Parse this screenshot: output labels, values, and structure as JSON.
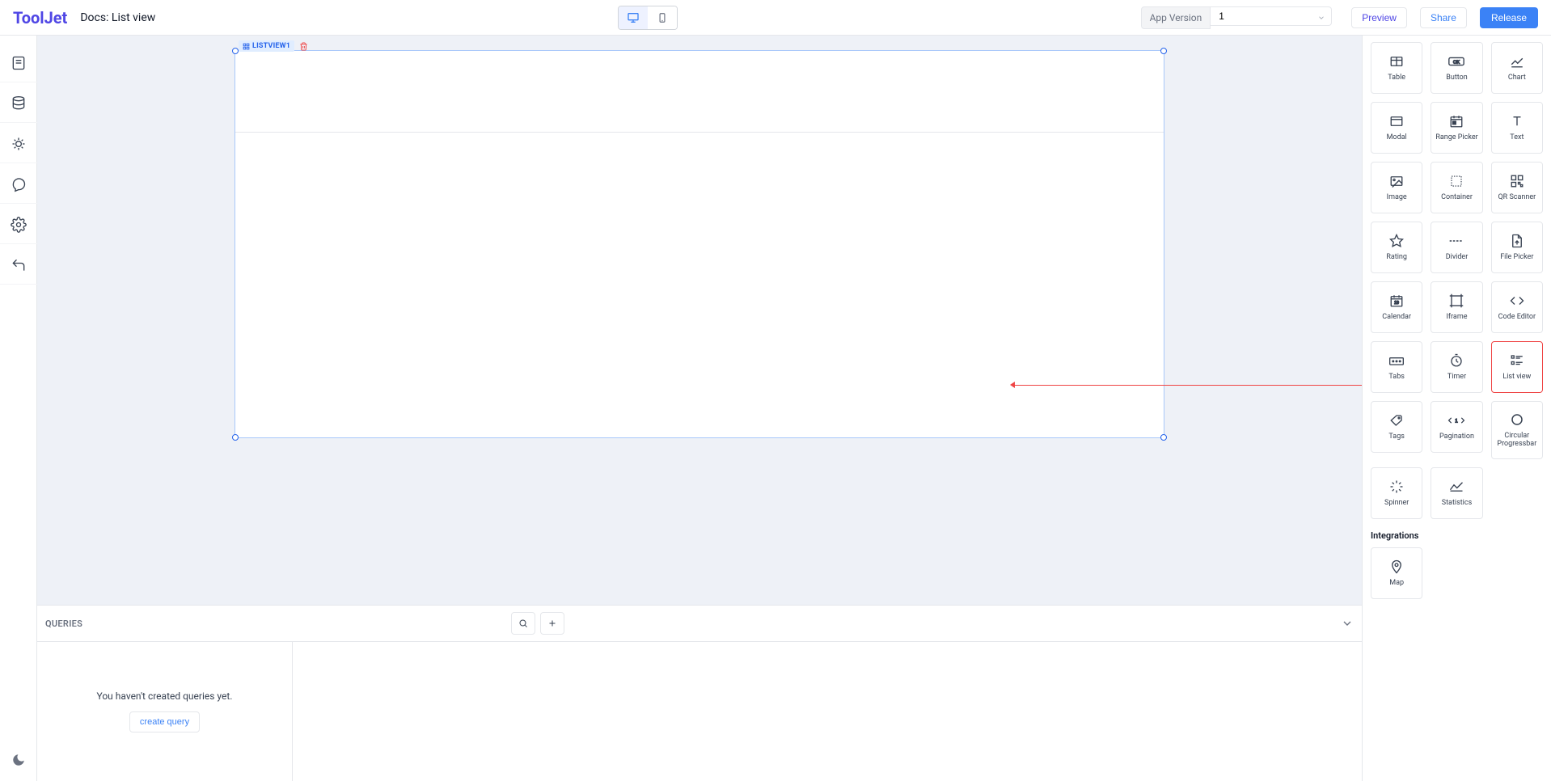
{
  "brand": "ToolJet",
  "docTitle": "Docs: List view",
  "topbar": {
    "appVersionLabel": "App Version",
    "appVersionValue": "1",
    "preview": "Preview",
    "share": "Share",
    "release": "Release"
  },
  "leftRail": {
    "items": [
      "page-icon",
      "database-icon",
      "debug-icon",
      "comment-icon",
      "settings-icon",
      "undo-icon"
    ]
  },
  "canvas": {
    "selectedComponent": "LISTVIEW1"
  },
  "queries": {
    "title": "QUERIES",
    "emptyText": "You haven't created queries yet.",
    "createLabel": "create query"
  },
  "components": {
    "items": [
      {
        "id": "table",
        "label": "Table",
        "icon": "table-icon"
      },
      {
        "id": "button",
        "label": "Button",
        "icon": "button-icon"
      },
      {
        "id": "chart",
        "label": "Chart",
        "icon": "chart-icon"
      },
      {
        "id": "modal",
        "label": "Modal",
        "icon": "modal-icon"
      },
      {
        "id": "rangepicker",
        "label": "Range Picker",
        "icon": "calendar-range-icon"
      },
      {
        "id": "text",
        "label": "Text",
        "icon": "text-icon"
      },
      {
        "id": "image",
        "label": "Image",
        "icon": "image-icon"
      },
      {
        "id": "container",
        "label": "Container",
        "icon": "container-icon"
      },
      {
        "id": "qrscanner",
        "label": "QR Scanner",
        "icon": "qr-icon"
      },
      {
        "id": "rating",
        "label": "Rating",
        "icon": "star-icon"
      },
      {
        "id": "divider",
        "label": "Divider",
        "icon": "divider-icon"
      },
      {
        "id": "filepicker",
        "label": "File Picker",
        "icon": "file-icon"
      },
      {
        "id": "calendar",
        "label": "Calendar",
        "icon": "calendar-icon"
      },
      {
        "id": "iframe",
        "label": "Iframe",
        "icon": "iframe-icon"
      },
      {
        "id": "codeeditor",
        "label": "Code Editor",
        "icon": "code-icon"
      },
      {
        "id": "tabs",
        "label": "Tabs",
        "icon": "tabs-icon"
      },
      {
        "id": "timer",
        "label": "Timer",
        "icon": "timer-icon"
      },
      {
        "id": "listview",
        "label": "List view",
        "icon": "list-icon",
        "highlight": true
      },
      {
        "id": "tags",
        "label": "Tags",
        "icon": "tag-icon"
      },
      {
        "id": "pagination",
        "label": "Pagination",
        "icon": "pagination-icon"
      },
      {
        "id": "circprog",
        "label": "Circular Progressbar",
        "icon": "circle-icon",
        "tall": true
      },
      {
        "id": "spinner",
        "label": "Spinner",
        "icon": "spinner-icon"
      },
      {
        "id": "statistics",
        "label": "Statistics",
        "icon": "stats-icon"
      }
    ],
    "integrationsTitle": "Integrations",
    "integrations": [
      {
        "id": "map",
        "label": "Map",
        "icon": "map-icon"
      }
    ]
  }
}
